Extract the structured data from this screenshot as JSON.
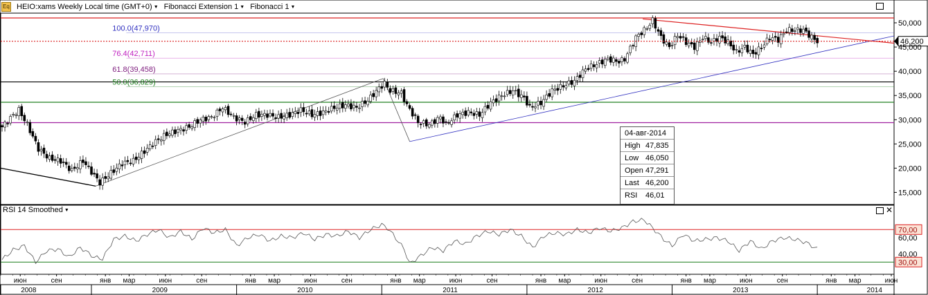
{
  "header": {
    "icon_label": "Eq",
    "symbol_label": "HEIO:xams Weekly Local time (GMT+0)",
    "indicator_1": "Fibonacci Extension 1",
    "indicator_2": "Fibonacci 1"
  },
  "fib_levels": [
    {
      "label": "100.0(47,970)",
      "value": 47.97,
      "color": "#3030c0"
    },
    {
      "label": "76.4(42,711)",
      "value": 42.711,
      "color": "#c020c0"
    },
    {
      "label": "61.8(39,458)",
      "value": 39.458,
      "color": "#802080"
    },
    {
      "label": "50.0(36,829)",
      "value": 36.829,
      "color": "#208020"
    }
  ],
  "price_axis": {
    "ticks": [
      "15,000",
      "20,000",
      "25,000",
      "30,000",
      "35,000",
      "40,000",
      "45,000",
      "50,000"
    ],
    "tick_values": [
      15,
      20,
      25,
      30,
      35,
      40,
      45,
      50
    ],
    "current_label": "46,200",
    "current_value": 46.2
  },
  "rsi": {
    "label": "RSI 14 Smoothed",
    "upper_label": "70,00",
    "lower_label": "30,00",
    "upper": 70,
    "lower": 30,
    "ticks": [
      "40,00",
      "60,00"
    ],
    "tick_values": [
      40,
      60
    ]
  },
  "time_axis": {
    "months": [
      {
        "label": "июн",
        "w": 7
      },
      {
        "label": "сен",
        "w": 20
      },
      {
        "label": "янв",
        "w": 37.5
      },
      {
        "label": "мар",
        "w": 46
      },
      {
        "label": "июн",
        "w": 59
      },
      {
        "label": "сен",
        "w": 72
      },
      {
        "label": "янв",
        "w": 89.5
      },
      {
        "label": "мар",
        "w": 98
      },
      {
        "label": "июн",
        "w": 111
      },
      {
        "label": "сен",
        "w": 124
      },
      {
        "label": "янв",
        "w": 141.5
      },
      {
        "label": "мар",
        "w": 150
      },
      {
        "label": "июн",
        "w": 163
      },
      {
        "label": "сен",
        "w": 176
      },
      {
        "label": "янв",
        "w": 193.5
      },
      {
        "label": "мар",
        "w": 202
      },
      {
        "label": "июн",
        "w": 215
      },
      {
        "label": "сен",
        "w": 228
      },
      {
        "label": "янв",
        "w": 245.5
      },
      {
        "label": "мар",
        "w": 254
      },
      {
        "label": "июн",
        "w": 267
      },
      {
        "label": "сен",
        "w": 280
      },
      {
        "label": "янв",
        "w": 297.5
      },
      {
        "label": "мар",
        "w": 306
      },
      {
        "label": "июн",
        "w": 319
      }
    ],
    "years": [
      {
        "label": "2008",
        "w": 10
      },
      {
        "label": "2009",
        "w": 57
      },
      {
        "label": "2010",
        "w": 109
      },
      {
        "label": "2011",
        "w": 161
      },
      {
        "label": "2012",
        "w": 213
      },
      {
        "label": "2013",
        "w": 265
      },
      {
        "label": "2014",
        "w": 313
      }
    ]
  },
  "tooltip": {
    "date": "04-авг-2014",
    "rows": [
      {
        "k": "High",
        "v": "47,835"
      },
      {
        "k": "Low",
        "v": "46,050"
      },
      {
        "k": "Open",
        "v": "47,291"
      },
      {
        "k": "Last",
        "v": "46,200"
      },
      {
        "k": "RSI",
        "v": "46,01"
      }
    ]
  },
  "chart_data": {
    "type": "candlestick",
    "title": "HEIO:xams Weekly",
    "ylim": [
      12.5,
      52
    ],
    "horizontal_lines": [
      {
        "value": 51.0,
        "color": "#dd2020"
      },
      {
        "value": 37.8,
        "color": "#000000"
      },
      {
        "value": 33.6,
        "color": "#208020"
      },
      {
        "value": 29.4,
        "color": "#a020a0"
      }
    ],
    "close_anchors": [
      [
        0,
        28.5
      ],
      [
        4,
        31
      ],
      [
        6,
        32
      ],
      [
        9,
        29
      ],
      [
        13,
        24
      ],
      [
        17,
        22
      ],
      [
        21,
        21.5
      ],
      [
        25,
        19.5
      ],
      [
        29,
        21.5
      ],
      [
        33,
        18.5
      ],
      [
        35,
        17
      ],
      [
        39,
        19
      ],
      [
        43,
        21
      ],
      [
        47,
        21.5
      ],
      [
        51,
        23.5
      ],
      [
        55,
        25.5
      ],
      [
        59,
        27
      ],
      [
        63,
        27.8
      ],
      [
        67,
        28.5
      ],
      [
        71,
        30
      ],
      [
        75,
        30.5
      ],
      [
        79,
        32.5
      ],
      [
        83,
        30.5
      ],
      [
        87,
        29.5
      ],
      [
        91,
        31
      ],
      [
        95,
        31
      ],
      [
        99,
        30.5
      ],
      [
        103,
        31
      ],
      [
        107,
        32
      ],
      [
        111,
        31
      ],
      [
        115,
        31.5
      ],
      [
        119,
        32.5
      ],
      [
        123,
        33
      ],
      [
        127,
        32.5
      ],
      [
        131,
        34
      ],
      [
        135,
        36.5
      ],
      [
        137,
        37.5
      ],
      [
        139,
        36
      ],
      [
        143,
        35.5
      ],
      [
        145,
        33
      ],
      [
        149,
        29.5
      ],
      [
        153,
        29
      ],
      [
        157,
        30.5
      ],
      [
        159,
        29
      ],
      [
        163,
        31
      ],
      [
        167,
        31.5
      ],
      [
        171,
        31
      ],
      [
        175,
        33.5
      ],
      [
        179,
        35
      ],
      [
        183,
        36
      ],
      [
        187,
        34.5
      ],
      [
        189,
        32.5
      ],
      [
        193,
        33.5
      ],
      [
        197,
        36
      ],
      [
        201,
        37
      ],
      [
        205,
        38
      ],
      [
        209,
        40.5
      ],
      [
        213,
        41.5
      ],
      [
        217,
        42.5
      ],
      [
        221,
        42
      ],
      [
        223,
        42.5
      ],
      [
        227,
        47
      ],
      [
        231,
        49
      ],
      [
        233,
        50.5
      ],
      [
        236,
        47
      ],
      [
        239,
        45
      ],
      [
        242,
        47.5
      ],
      [
        245,
        46
      ],
      [
        248,
        45
      ],
      [
        251,
        47
      ],
      [
        254,
        46
      ],
      [
        257,
        47
      ],
      [
        260,
        46
      ],
      [
        263,
        44
      ],
      [
        266,
        45
      ],
      [
        269,
        43.5
      ],
      [
        272,
        45
      ],
      [
        275,
        47
      ],
      [
        278,
        46.5
      ],
      [
        281,
        48.5
      ],
      [
        284,
        48.5
      ],
      [
        287,
        48.5
      ],
      [
        290,
        47
      ],
      [
        292,
        46.2
      ]
    ],
    "rsi_anchors": [
      [
        0,
        33
      ],
      [
        4,
        45
      ],
      [
        8,
        50
      ],
      [
        10,
        40
      ],
      [
        12,
        30
      ],
      [
        16,
        44
      ],
      [
        20,
        46
      ],
      [
        24,
        36
      ],
      [
        28,
        48
      ],
      [
        33,
        36
      ],
      [
        36,
        34
      ],
      [
        40,
        58
      ],
      [
        44,
        62
      ],
      [
        48,
        56
      ],
      [
        52,
        64
      ],
      [
        56,
        70
      ],
      [
        60,
        60
      ],
      [
        64,
        68
      ],
      [
        68,
        58
      ],
      [
        72,
        72
      ],
      [
        76,
        66
      ],
      [
        80,
        70
      ],
      [
        84,
        50
      ],
      [
        88,
        60
      ],
      [
        92,
        64
      ],
      [
        96,
        56
      ],
      [
        100,
        62
      ],
      [
        104,
        60
      ],
      [
        108,
        66
      ],
      [
        112,
        58
      ],
      [
        116,
        64
      ],
      [
        120,
        62
      ],
      [
        124,
        68
      ],
      [
        128,
        60
      ],
      [
        132,
        70
      ],
      [
        136,
        76
      ],
      [
        138,
        72
      ],
      [
        140,
        64
      ],
      [
        144,
        46
      ],
      [
        146,
        28
      ],
      [
        150,
        38
      ],
      [
        154,
        48
      ],
      [
        158,
        44
      ],
      [
        162,
        56
      ],
      [
        166,
        52
      ],
      [
        170,
        62
      ],
      [
        174,
        68
      ],
      [
        178,
        64
      ],
      [
        182,
        70
      ],
      [
        186,
        62
      ],
      [
        190,
        48
      ],
      [
        194,
        62
      ],
      [
        198,
        66
      ],
      [
        202,
        64
      ],
      [
        206,
        70
      ],
      [
        210,
        66
      ],
      [
        214,
        72
      ],
      [
        218,
        68
      ],
      [
        222,
        72
      ],
      [
        226,
        80
      ],
      [
        230,
        82
      ],
      [
        233,
        72
      ],
      [
        237,
        58
      ],
      [
        240,
        50
      ],
      [
        244,
        64
      ],
      [
        248,
        56
      ],
      [
        252,
        58
      ],
      [
        256,
        60
      ],
      [
        260,
        56
      ],
      [
        264,
        44
      ],
      [
        268,
        56
      ],
      [
        272,
        46
      ],
      [
        276,
        56
      ],
      [
        280,
        60
      ],
      [
        284,
        58
      ],
      [
        288,
        54
      ],
      [
        292,
        46
      ]
    ]
  }
}
